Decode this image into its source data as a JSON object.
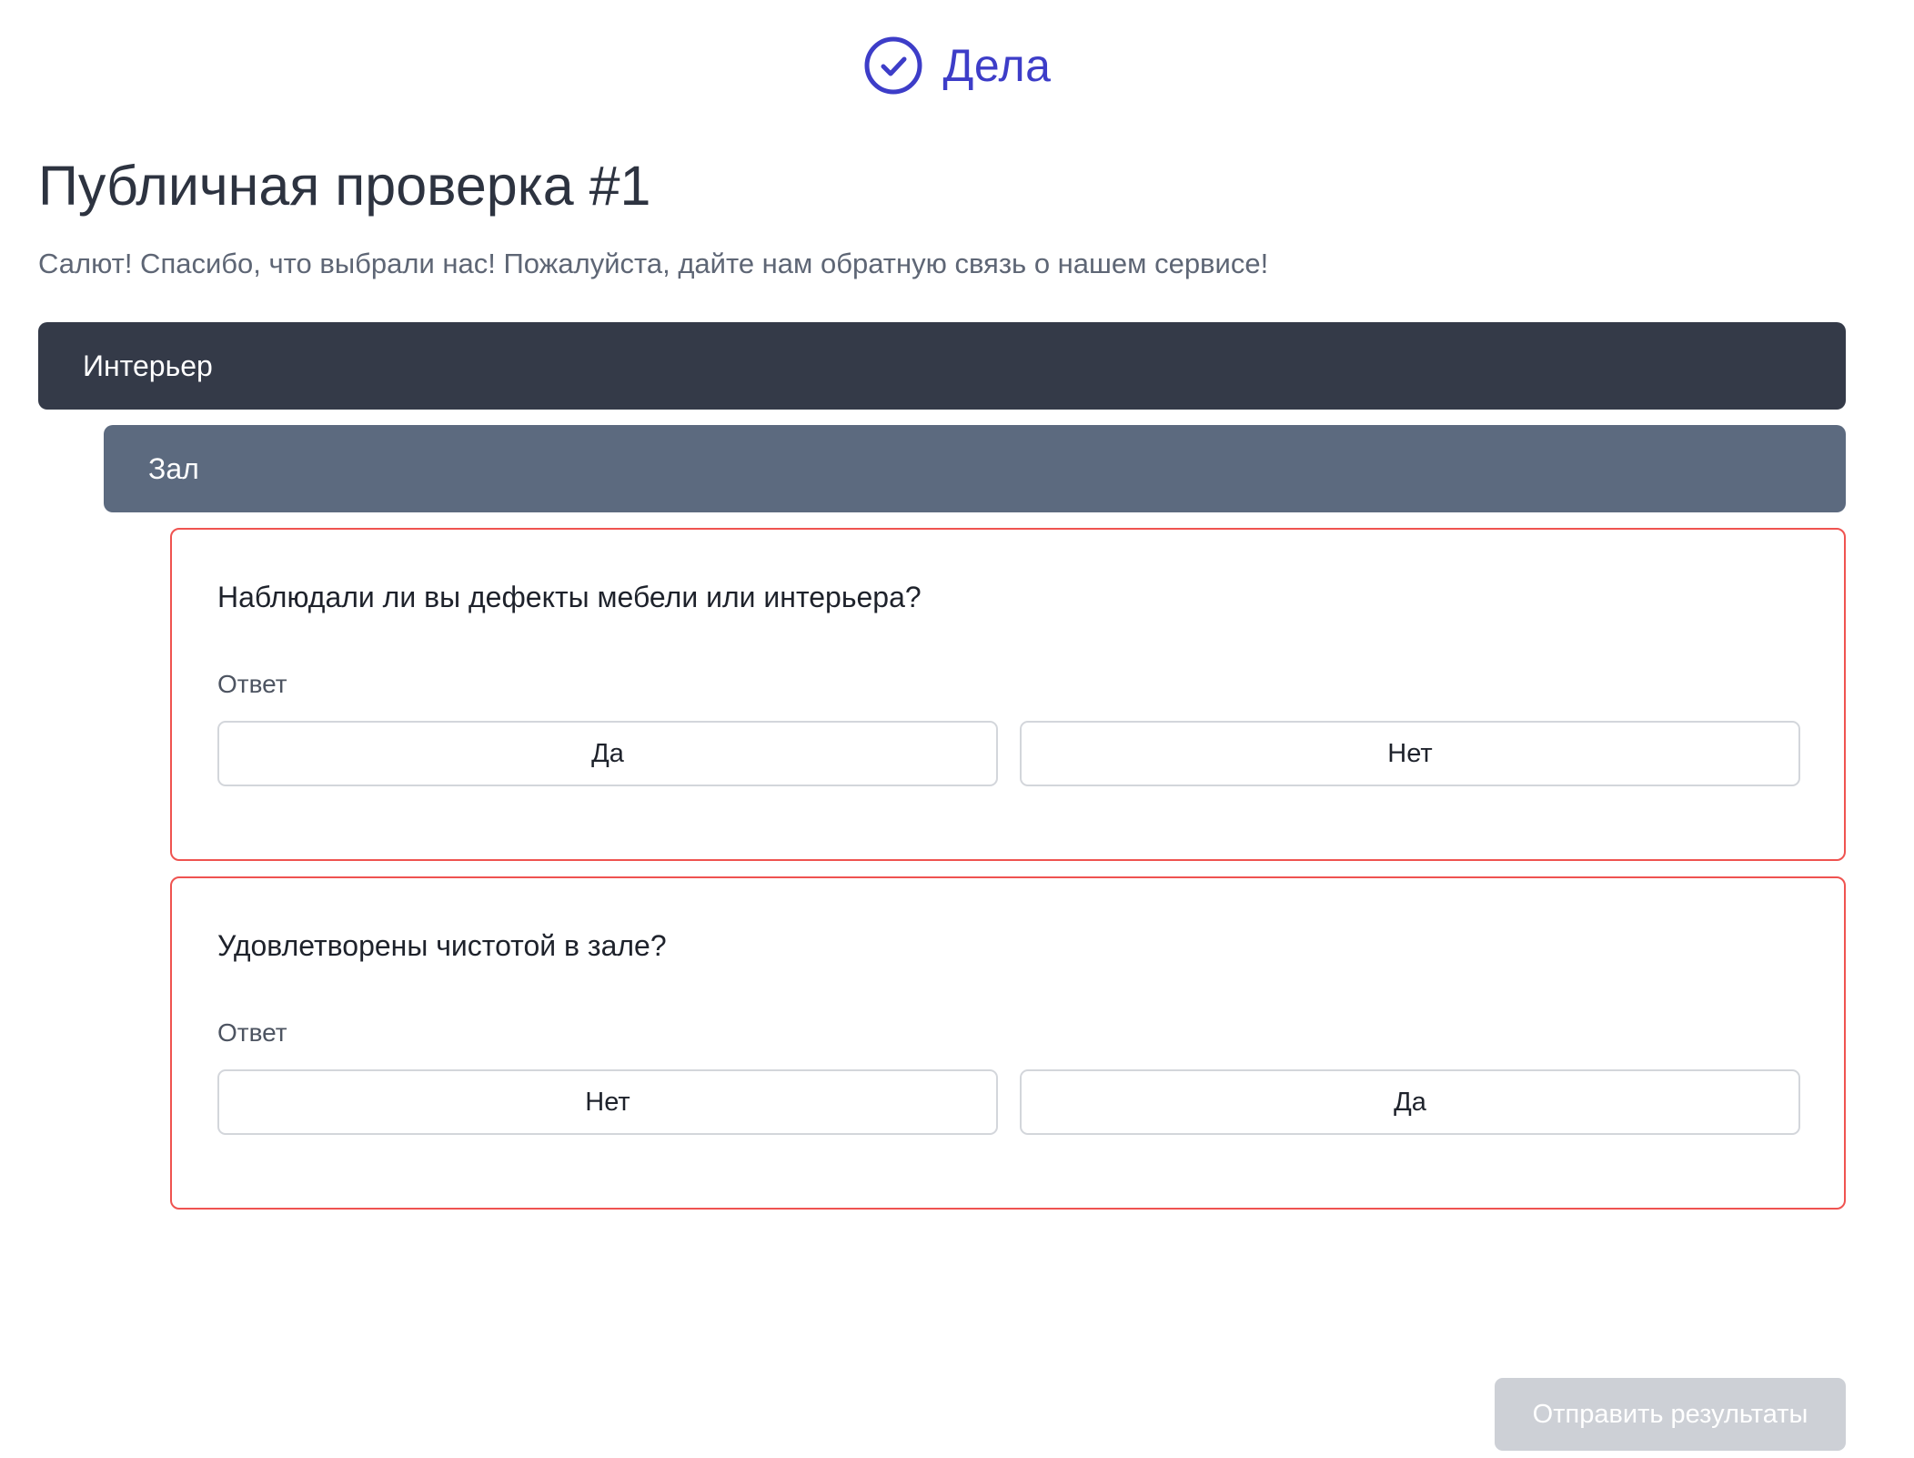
{
  "header": {
    "brand": "Дела",
    "brand_icon": "check-circle-icon",
    "accent_color": "#3d3dc8"
  },
  "page": {
    "title": "Публичная проверка #1",
    "subtitle": "Салют! Спасибо, что выбрали нас! Пожалуйста, дайте нам обратную связь о нашем сервисе!"
  },
  "section": {
    "label": "Интерьер",
    "subsection": {
      "label": "Зал",
      "questions": [
        {
          "text": "Наблюдали ли вы дефекты мебели или интерьера?",
          "answer_label": "Ответ",
          "options": [
            "Да",
            "Нет"
          ]
        },
        {
          "text": "Удовлетворены чистотой в зале?",
          "answer_label": "Ответ",
          "options": [
            "Нет",
            "Да"
          ]
        }
      ]
    }
  },
  "footer": {
    "submit_label": "Отправить результаты",
    "submit_state": "disabled"
  },
  "colors": {
    "section_bg": "#343a48",
    "subsection_bg": "#5c6a7f",
    "error_border": "#ef5350",
    "submit_disabled_bg": "#cdd0d6"
  }
}
